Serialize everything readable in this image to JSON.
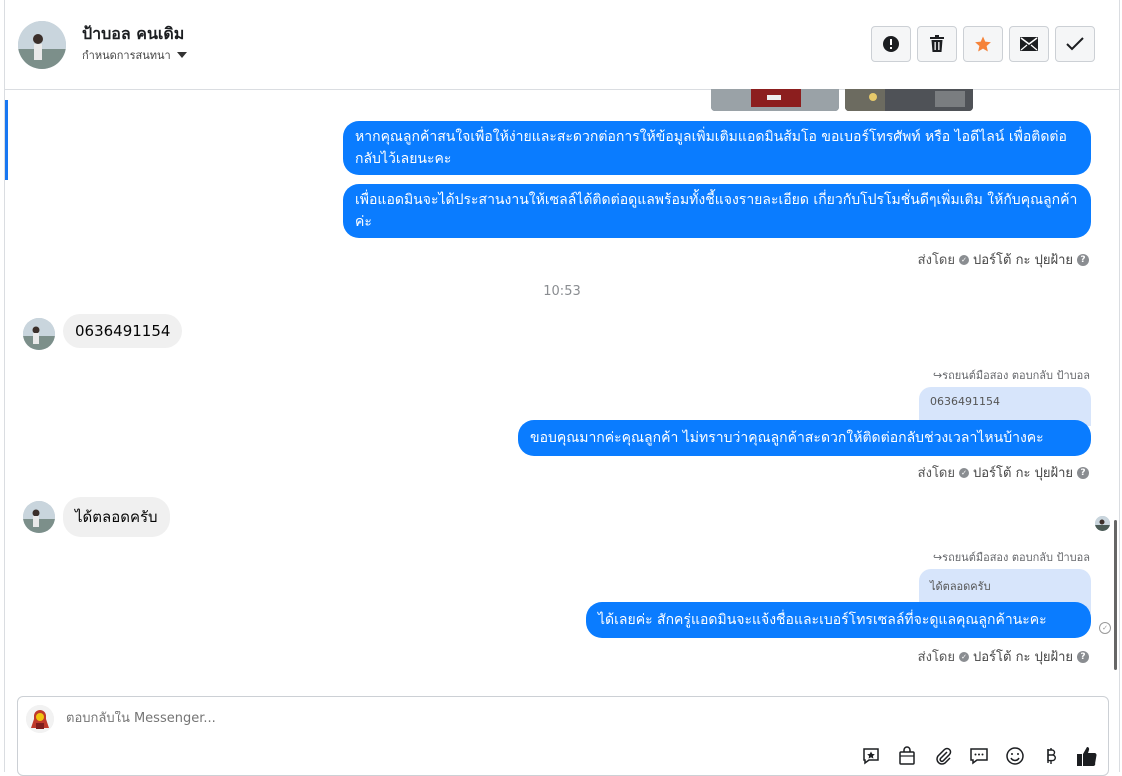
{
  "header": {
    "name": "ป้าบอล คนเดิม",
    "subtitle": "กำหนดการสนทนา",
    "toolbar": [
      "alert-icon",
      "trash-icon",
      "star-icon",
      "mail-icon",
      "check-icon"
    ],
    "colors": {
      "star": "#f5833a",
      "accent": "#1877f2"
    }
  },
  "messages": {
    "m1": "หากคุณลูกค้าสนใจเพื่อให้ง่ายและสะดวกต่อการให้ข้อมูลเพิ่มเติมแอดมินส้มโอ ขอเบอร์โทรศัพท์ หรือ ไอดีไลน์ เพื่อติดต่อกลับไว้เลยนะคะ",
    "m2": "เพื่อแอดมินจะได้ประสานงานให้เซลล์ได้ติดต่อดูแลพร้อมทั้งชี้แจงรายละเอียด เกี่ยวกับโปรโมชั่นดีๆเพิ่มเติม ให้กับคุณลูกค้าค่ะ",
    "sent_by_1": "ส่งโดย",
    "sender_1": "ปอร์โต้ กะ ปุยฝ้าย",
    "time": "10:53",
    "in1": "0636491154",
    "reply_note_1": "รถยนต์มือสอง ตอบกลับ ป้าบอล",
    "quote_1": "0636491154",
    "m3": "ขอบคุณมากค่ะคุณลูกค้า ไม่ทราบว่าคุณลูกค้าสะดวกให้ติดต่อกลับช่วงเวลาไหนบ้างคะ",
    "sent_by_2": "ส่งโดย",
    "sender_2": "ปอร์โต้ กะ ปุยฝ้าย",
    "in2": "ได้ตลอดครับ",
    "reply_note_2": "รถยนต์มือสอง ตอบกลับ ป้าบอล",
    "quote_2": "ได้ตลอดครับ",
    "m4": "ได้เลยค่ะ สักครู่แอดมินจะแจ้งชื่อและเบอร์โทรเซลล์ที่จะดูแลคุณลูกค้านะคะ",
    "sent_by_3": "ส่งโดย",
    "sender_3": "ปอร์โต้ กะ ปุยฝ้าย",
    "bubble_color": "#0a7cff"
  },
  "composer": {
    "placeholder": "ตอบกลับใน Messenger...",
    "icons": [
      "star-bubble-icon",
      "bag-icon",
      "paperclip-icon",
      "comment-icon",
      "smiley-icon",
      "baht-icon",
      "thumbs-up-icon"
    ]
  }
}
